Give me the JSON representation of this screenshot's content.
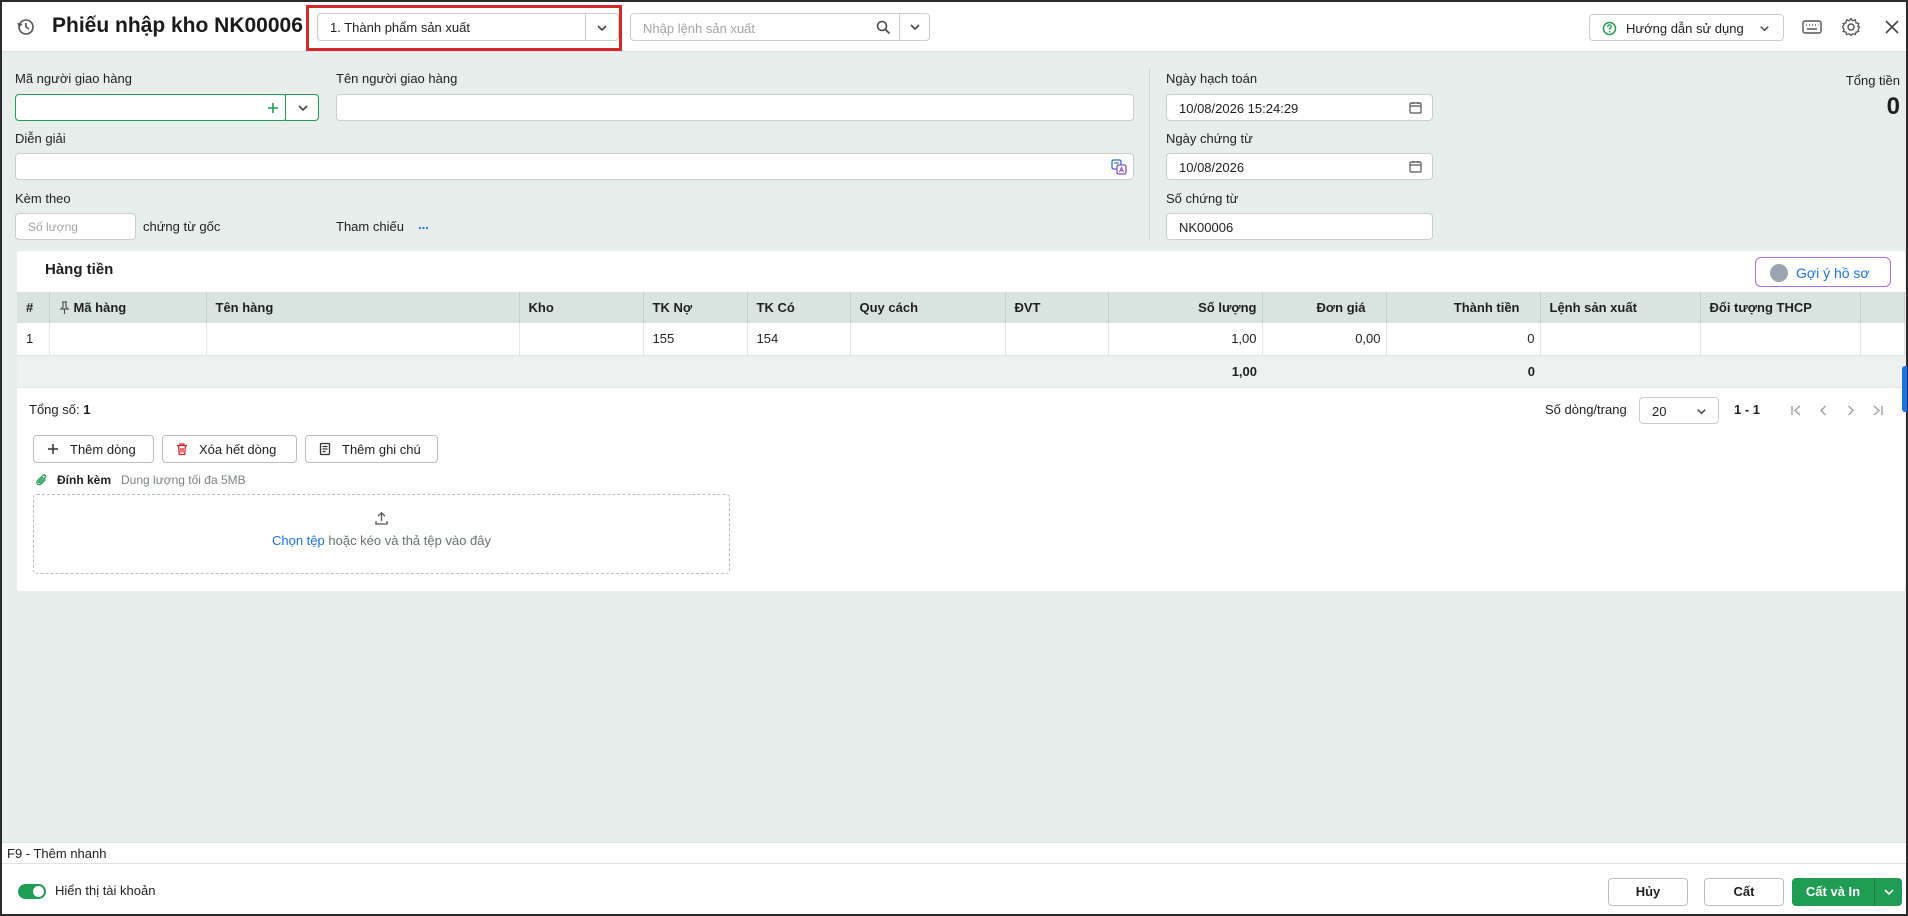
{
  "header": {
    "title": "Phiếu nhập kho NK00006",
    "voucher_type": "1. Thành phẩm sản xuất",
    "production_order_placeholder": "Nhập lệnh sản xuất",
    "help_label": "Hướng dẫn sử dụng"
  },
  "form": {
    "deliverer_code_label": "Mã người giao hàng",
    "deliverer_code_value": "",
    "deliverer_name_label": "Tên người giao hàng",
    "deliverer_name_value": "",
    "description_label": "Diễn giải",
    "description_value": "",
    "attach_label": "Kèm theo",
    "attach_qty_placeholder": "Số lượng",
    "attach_suffix": "chứng từ gốc",
    "reference_label": "Tham chiếu",
    "reference_link": "...",
    "posting_date_label": "Ngày hạch toán",
    "posting_date_value": "10/08/2026 15:24:29",
    "voucher_date_label": "Ngày chứng từ",
    "voucher_date_value": "10/08/2026",
    "voucher_no_label": "Số chứng từ",
    "voucher_no_value": "NK00006",
    "total_label": "Tổng tiền",
    "total_value": "0"
  },
  "items": {
    "title": "Hàng tiền",
    "suggest_label": "Gợi ý hồ sơ",
    "columns": [
      "#",
      "Mã hàng",
      "Tên hàng",
      "Kho",
      "TK Nợ",
      "TK Có",
      "Quy cách",
      "ĐVT",
      "Số lượng",
      "Đơn giá",
      "Thành tiền",
      "Lệnh sản xuất",
      "Đối tượng THCP"
    ],
    "rows": [
      {
        "no": "1",
        "code": "",
        "name": "",
        "warehouse": "",
        "debit": "155",
        "credit": "154",
        "spec": "",
        "unit": "",
        "qty": "1,00",
        "price": "0,00",
        "amount": "0",
        "order": "",
        "cost_object": ""
      }
    ],
    "totals": {
      "qty": "1,00",
      "amount": "0"
    },
    "summary_label": "Tổng số:",
    "summary_value": "1",
    "rows_per_page_label": "Số dòng/trang",
    "rows_per_page": "20",
    "range": "1 - 1",
    "add_row_label": "Thêm dòng",
    "delete_rows_label": "Xóa hết dòng",
    "add_note_label": "Thêm ghi chú"
  },
  "attachment": {
    "label": "Đính kèm",
    "hint": "Dung lượng tối đa 5MB",
    "choose_file": "Chọn tệp",
    "drop_text": "hoặc kéo và thả tệp vào đây"
  },
  "footer": {
    "shortcut": "F9 - Thêm nhanh",
    "show_accounts_label": "Hiển thị tài khoản",
    "show_accounts_on": true,
    "cancel_label": "Hủy",
    "save_label": "Cất",
    "save_print_label": "Cất và In"
  },
  "colors": {
    "primary": "#1f9d55",
    "highlight": "#d7262c",
    "link": "#1a73e8",
    "background": "#e7eeec"
  }
}
